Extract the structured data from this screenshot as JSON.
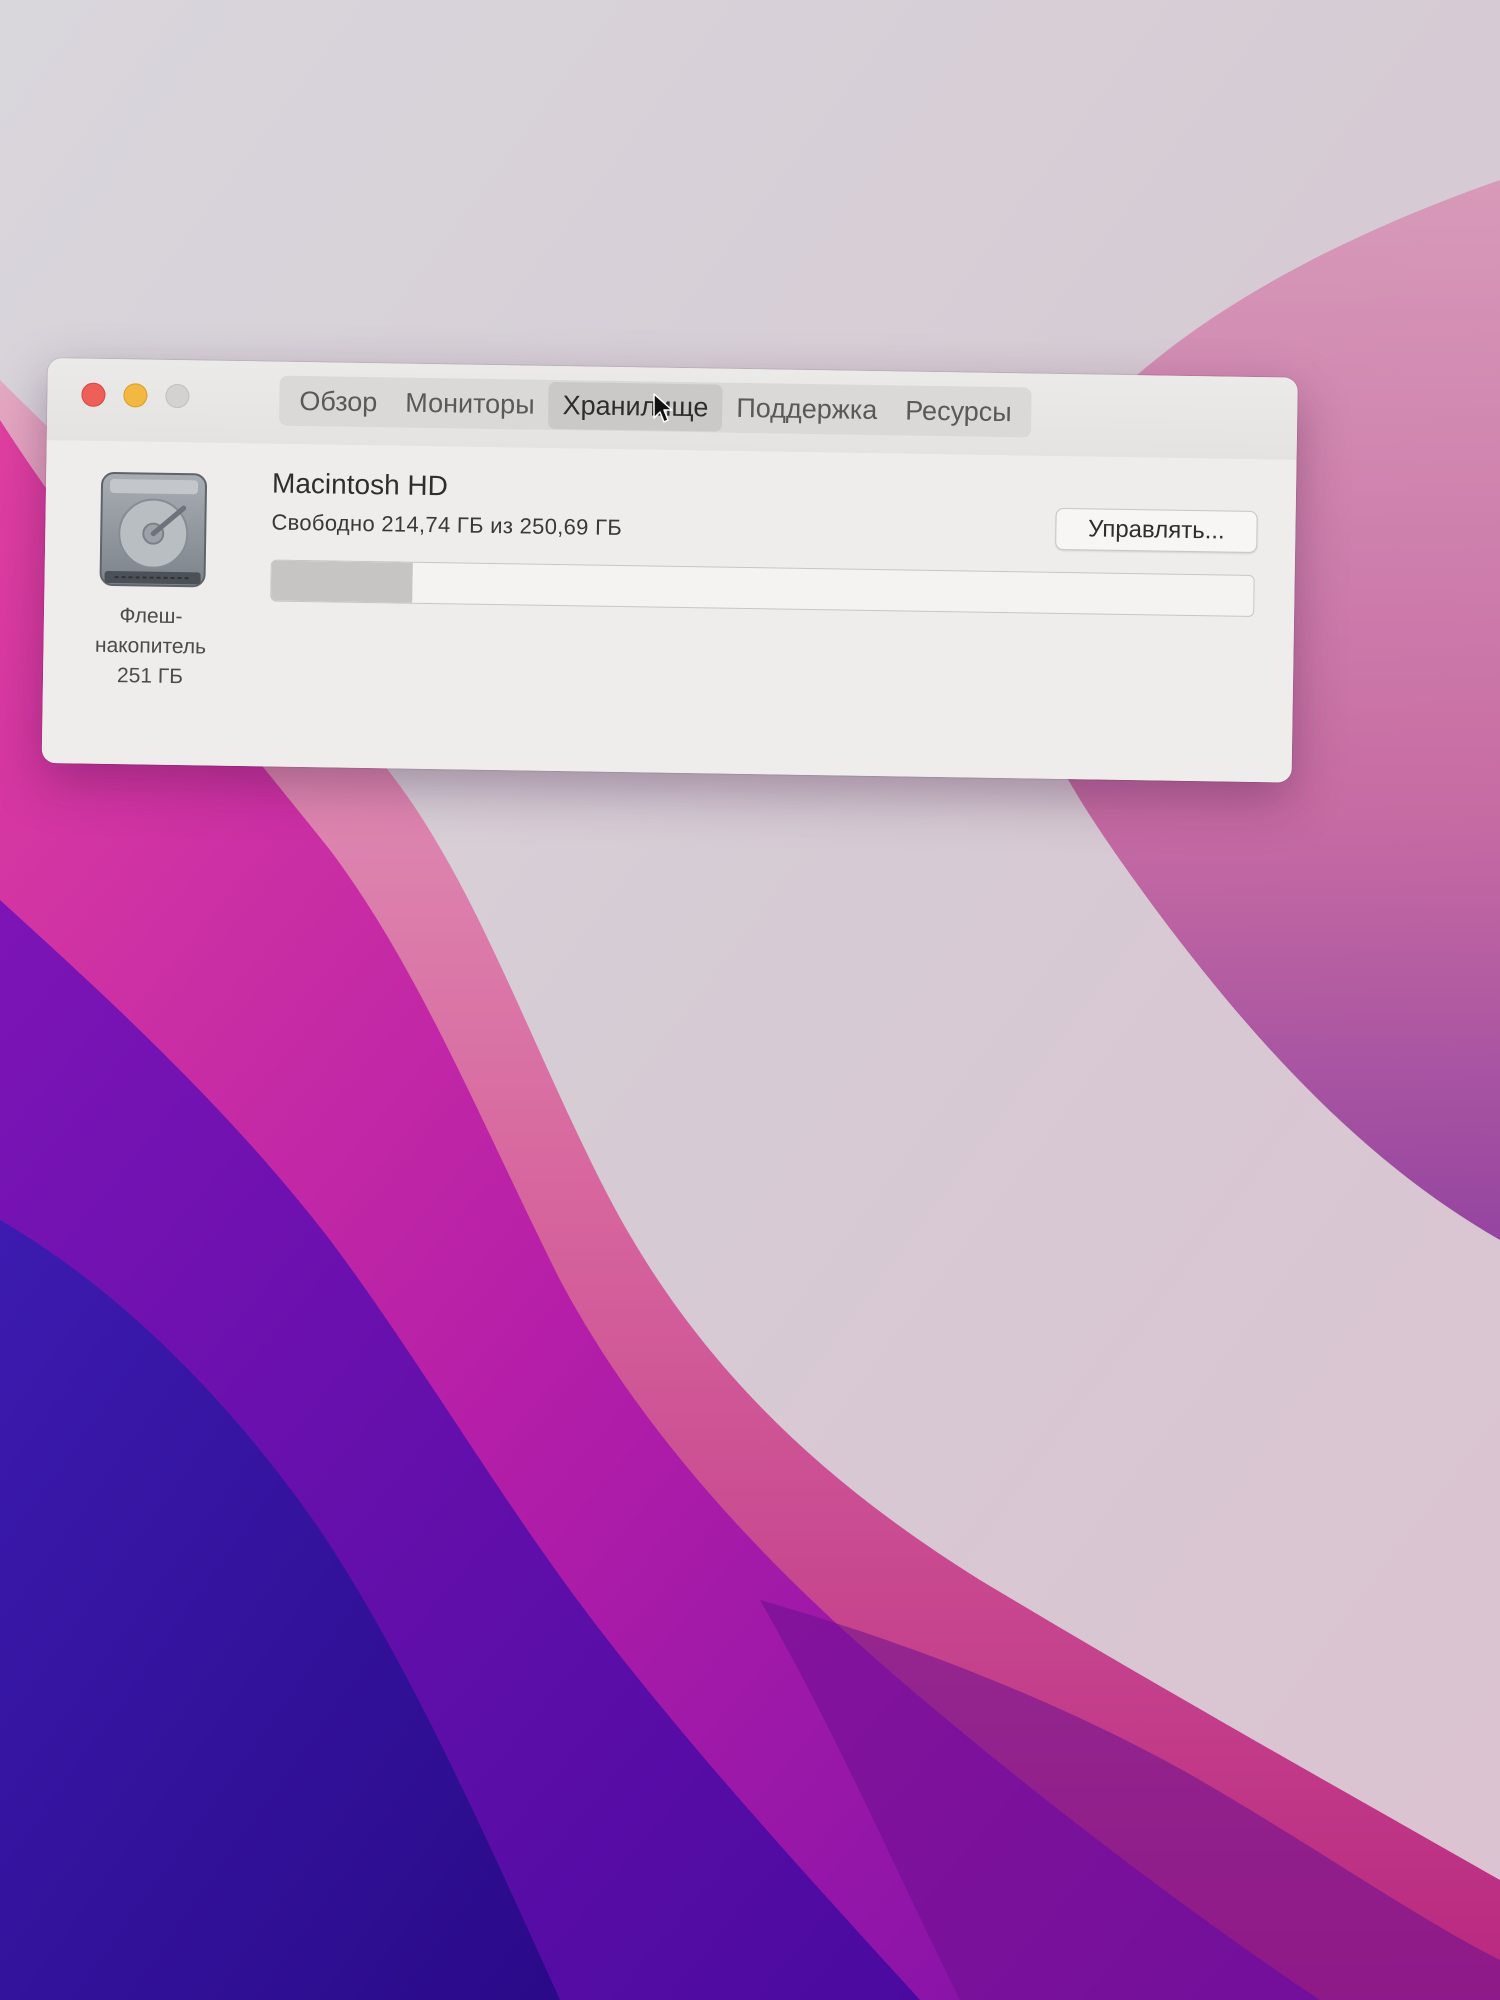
{
  "window": {
    "tabs": [
      {
        "label": "Обзор",
        "active": false
      },
      {
        "label": "Мониторы",
        "active": false
      },
      {
        "label": "Хранилище",
        "active": true
      },
      {
        "label": "Поддержка",
        "active": false
      },
      {
        "label": "Ресурсы",
        "active": false
      }
    ]
  },
  "disk": {
    "icon": "hard-drive-icon",
    "caption_line1": "Флеш-",
    "caption_line2": "накопитель",
    "caption_line3": "251 ГБ"
  },
  "volume": {
    "name": "Macintosh HD",
    "free_text": "Свободно 214,74 ГБ из 250,69 ГБ",
    "used_fraction": 0.1434
  },
  "manage_button": {
    "label": "Управлять..."
  },
  "colors": {
    "close": "#ed5f58",
    "minimize": "#f2b842",
    "zoom_inactive": "#d4d2d1",
    "wallpaper_purple": "#6a1aa0",
    "wallpaper_magenta": "#c2318f",
    "wallpaper_pink": "#e8a8c4"
  }
}
